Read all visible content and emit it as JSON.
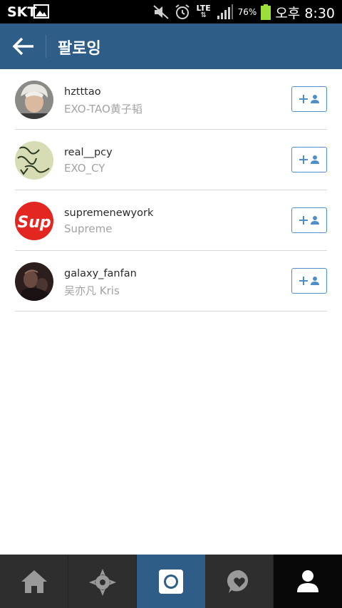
{
  "status_bar": {
    "carrier": "SKT",
    "network": "LTE",
    "battery_percent": "76%",
    "time": "오후 8:30",
    "icons": [
      "image-icon",
      "mute-icon",
      "alarm-icon",
      "lte-icon",
      "signal-icon",
      "battery-icon"
    ],
    "battery_color": "#9be03a"
  },
  "header": {
    "title": "팔로잉",
    "back_icon": "back-arrow-icon",
    "background": "#2e5d88"
  },
  "following": [
    {
      "username": "hztttao",
      "full_name": "EXO-TAO黄子韬",
      "avatar": "portrait-photo",
      "action_icon": "add-user-icon"
    },
    {
      "username": "real__pcy",
      "full_name": "EXO_CY",
      "avatar": "handwriting-photo",
      "action_icon": "add-user-icon"
    },
    {
      "username": "supremenewyork",
      "full_name": "Supreme",
      "avatar": "supreme-logo",
      "action_icon": "add-user-icon"
    },
    {
      "username": "galaxy_fanfan",
      "full_name": "吴亦凡 Kris",
      "avatar": "dark-portrait-photo",
      "action_icon": "add-user-icon"
    }
  ],
  "bottom_nav": {
    "items": [
      "home-icon",
      "explore-icon",
      "camera-icon",
      "activity-icon",
      "profile-icon"
    ],
    "active": "profile-icon",
    "accent": "#2e5d88"
  }
}
